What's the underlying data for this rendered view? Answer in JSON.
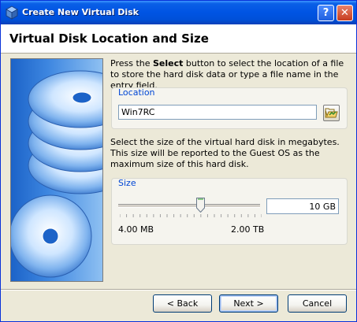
{
  "window": {
    "title": "Create New Virtual Disk"
  },
  "titlebar_buttons": {
    "help": "?",
    "close": "✕"
  },
  "header": {
    "title": "Virtual Disk Location and Size"
  },
  "location_section": {
    "instruction_before": "Press the ",
    "instruction_bold": "Select",
    "instruction_after": " button to select the location of a file to store the hard disk data or type a file name in the entry field.",
    "label": "Location",
    "value": "Win7RC"
  },
  "size_section": {
    "instruction": "Select the size of the virtual hard disk in megabytes. This size will be reported to the Guest OS as the maximum size of this hard disk.",
    "label": "Size",
    "value": "10 GB",
    "slider_fraction": 0.58,
    "min_label": "4.00 MB",
    "max_label": "2.00 TB"
  },
  "footer": {
    "back": "< Back",
    "next": "Next >",
    "cancel": "Cancel"
  },
  "icons": {
    "app": "virtualbox-cube-icon",
    "browse": "folder-open-icon",
    "side": "stacked-disks-illustration"
  },
  "colors": {
    "title_gradient_mid": "#0054e3",
    "group_label": "#0046d5",
    "side_bg": "#3d86e0"
  }
}
